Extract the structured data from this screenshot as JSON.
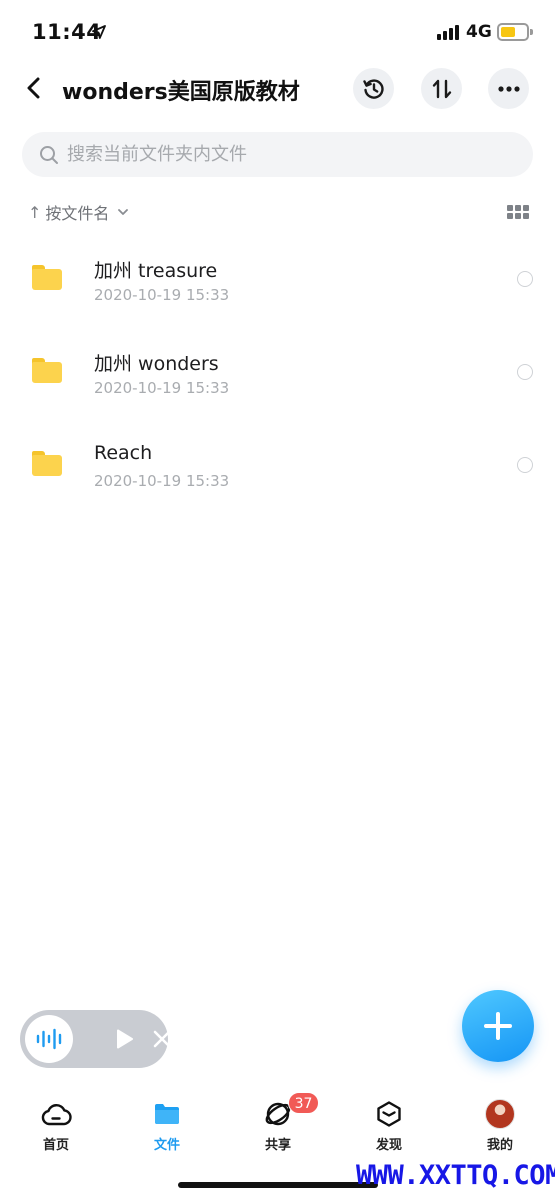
{
  "status_bar": {
    "time": "11:44",
    "network": "4G"
  },
  "header": {
    "title": "wonders美国原版教材"
  },
  "search": {
    "placeholder": "搜索当前文件夹内文件"
  },
  "sort": {
    "arrow": "↑",
    "label": "按文件名"
  },
  "files": [
    {
      "name": "加州 treasure",
      "date": "2020-10-19 15:33",
      "icon": "folder-icon"
    },
    {
      "name": "加州 wonders",
      "date": "2020-10-19 15:33",
      "icon": "folder-icon"
    },
    {
      "name": "Reach",
      "date": "2020-10-19 15:33",
      "icon": "folder-icon"
    }
  ],
  "tab_bar": {
    "items": [
      {
        "label": "首页",
        "icon": "cloud-icon",
        "active": false
      },
      {
        "label": "文件",
        "icon": "folder-icon",
        "active": true
      },
      {
        "label": "共享",
        "icon": "orbit-icon",
        "active": false,
        "badge": "37"
      },
      {
        "label": "发现",
        "icon": "cube-icon",
        "active": false
      },
      {
        "label": "我的",
        "icon": "avatar",
        "active": false
      }
    ]
  },
  "watermark": "WWW.XXTTQ.COM",
  "colors": {
    "accent": "#1e9bf0",
    "folder": "#fcd34d",
    "badge": "#f15a56",
    "watermark": "#1717e6"
  }
}
